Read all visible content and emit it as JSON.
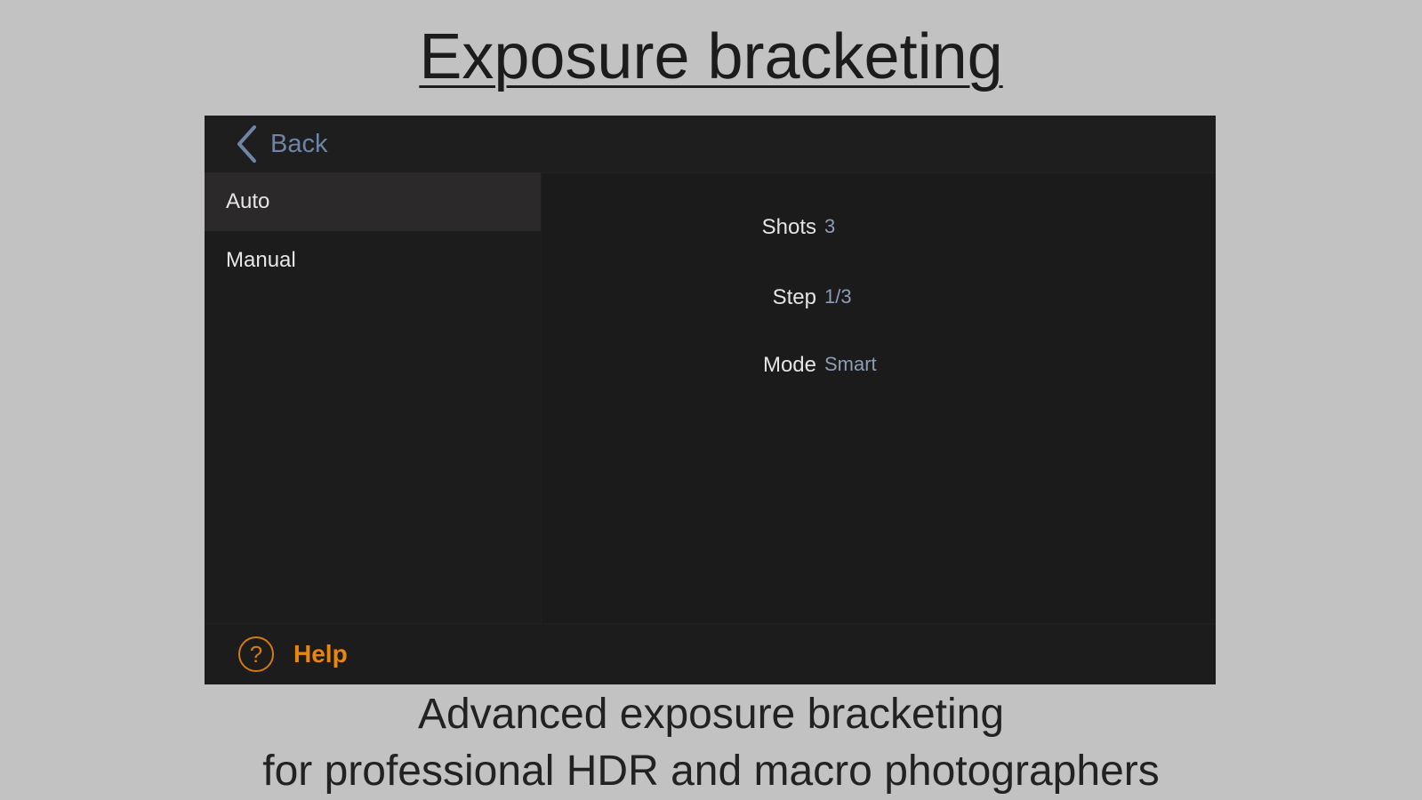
{
  "headline": "Exposure bracketing",
  "app": {
    "back_label": "Back",
    "sidebar": {
      "items": [
        {
          "label": "Auto",
          "selected": true
        },
        {
          "label": "Manual",
          "selected": false
        }
      ]
    },
    "settings": {
      "shots": {
        "label": "Shots",
        "value": "3"
      },
      "step": {
        "label": "Step",
        "value": "1/3"
      },
      "mode": {
        "label": "Mode",
        "value": "Smart"
      }
    },
    "help_label": "Help",
    "help_icon_glyph": "?"
  },
  "caption": {
    "line1": "Advanced exposure bracketing",
    "line2": "for professional HDR and macro photographers"
  },
  "colors": {
    "background": "#c2c2c2",
    "screen": "#1b1b1c",
    "selected_row": "#2b2929",
    "accent_blue": "#6f84a6",
    "help_orange": "#e8860f"
  },
  "icons": {
    "back": "chevron-left-icon",
    "help": "help-circle-icon"
  }
}
